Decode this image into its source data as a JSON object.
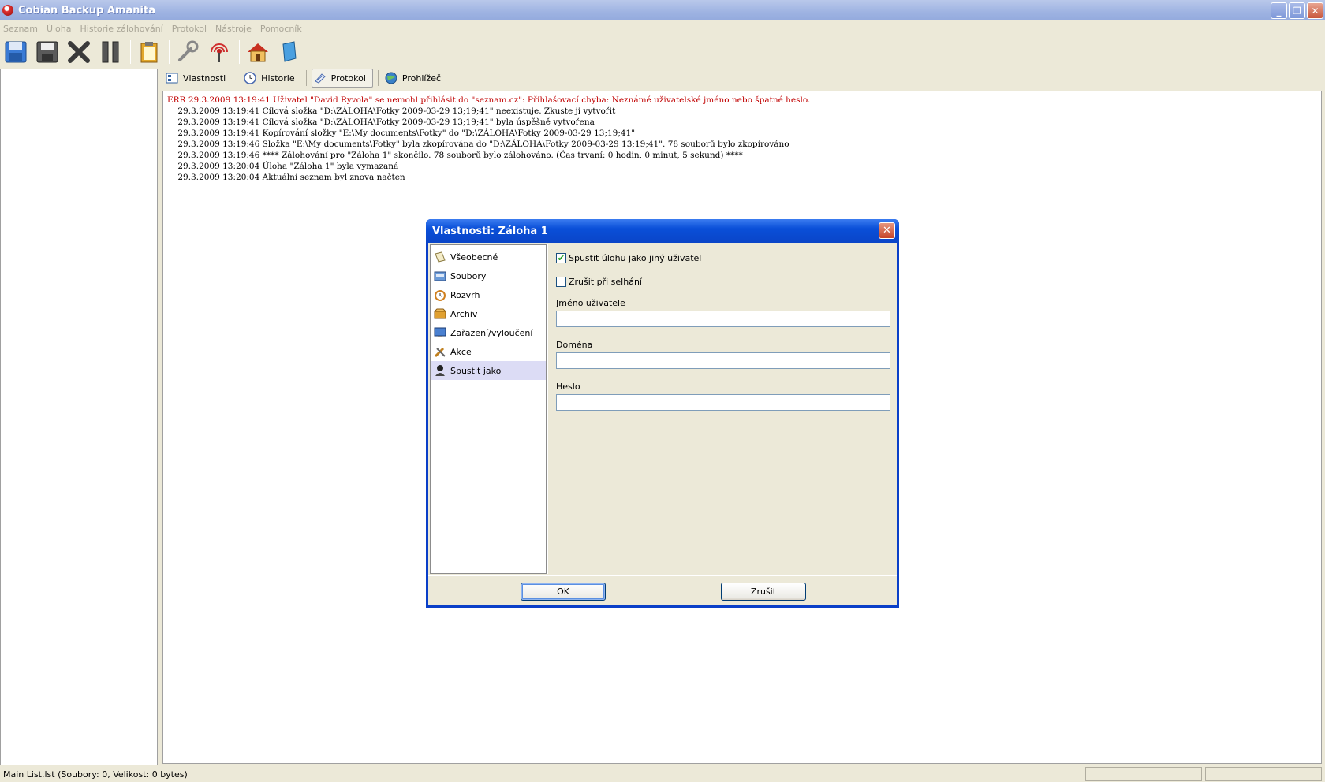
{
  "window": {
    "title": "Cobian Backup Amanita"
  },
  "menu": [
    "Seznam",
    "Úloha",
    "Historie zálohování",
    "Protokol",
    "Nástroje",
    "Pomocník"
  ],
  "toolbar": {
    "icons": [
      "backup-icon",
      "save-icon",
      "delete-icon",
      "pause-icon",
      "clipboard-icon",
      "wrench-icon",
      "antenna-icon",
      "home-icon",
      "book-icon"
    ]
  },
  "tabs": [
    {
      "label": "Vlastnosti",
      "icon": "properties-icon",
      "active": false
    },
    {
      "label": "Historie",
      "icon": "clock-icon",
      "active": false
    },
    {
      "label": "Protokol",
      "icon": "log-icon",
      "active": true
    },
    {
      "label": "Prohlížeč",
      "icon": "globe-icon",
      "active": false
    }
  ],
  "log": {
    "lines": [
      {
        "text": "ERR 29.3.2009 13:19:41 Uživatel \"David Ryvola\" se nemohl přihlásit do \"seznam.cz\": Přihlašovací chyba: Neznámé uživatelské jméno nebo špatné heslo.",
        "error": true
      },
      {
        "text": "    29.3.2009 13:19:41 Cílová složka \"D:\\ZÁLOHA\\Fotky 2009-03-29 13;19;41\" neexistuje. Zkuste ji vytvořit",
        "error": false
      },
      {
        "text": "    29.3.2009 13:19:41 Cílová složka \"D:\\ZÁLOHA\\Fotky 2009-03-29 13;19;41\" byla úspěšně vytvořena",
        "error": false
      },
      {
        "text": "    29.3.2009 13:19:41 Kopírování složky \"E:\\My documents\\Fotky\" do \"D:\\ZÁLOHA\\Fotky 2009-03-29 13;19;41\"",
        "error": false
      },
      {
        "text": "    29.3.2009 13:19:46 Složka \"E:\\My documents\\Fotky\" byla zkopírována do \"D:\\ZÁLOHA\\Fotky 2009-03-29 13;19;41\". 78 souborů bylo zkopírováno",
        "error": false
      },
      {
        "text": "    29.3.2009 13:19:46 **** Zálohování pro \"Záloha 1\" skončilo. 78 souborů bylo zálohováno. (Čas trvaní: 0 hodin, 0 minut, 5 sekund) ****",
        "error": false
      },
      {
        "text": "    29.3.2009 13:20:04 Úloha \"Záloha 1\" byla vymazaná",
        "error": false
      },
      {
        "text": "    29.3.2009 13:20:04 Aktuální seznam byl znova načten",
        "error": false
      }
    ]
  },
  "status": {
    "text": "Main List.lst (Soubory: 0, Velikost: 0 bytes)"
  },
  "dialog": {
    "title": "Vlastnosti: Záloha 1",
    "nav": [
      {
        "label": "Všeobecné",
        "icon": "general-icon",
        "selected": false
      },
      {
        "label": "Soubory",
        "icon": "files-icon",
        "selected": false
      },
      {
        "label": "Rozvrh",
        "icon": "alarm-clock-icon",
        "selected": false
      },
      {
        "label": "Archiv",
        "icon": "archive-icon",
        "selected": false
      },
      {
        "label": "Zařazení/vyloučení",
        "icon": "monitor-icon",
        "selected": false
      },
      {
        "label": "Akce",
        "icon": "tools-icon",
        "selected": false
      },
      {
        "label": "Spustit jako",
        "icon": "user-icon",
        "selected": true
      }
    ],
    "run_as_other_user": {
      "label": "Spustit úlohu jako jiný uživatel",
      "checked": true
    },
    "cancel_on_fail": {
      "label": "Zrušit při selhání",
      "checked": false
    },
    "username": {
      "label": "Jméno uživatele",
      "value": ""
    },
    "domain": {
      "label": "Doména",
      "value": ""
    },
    "password": {
      "label": "Heslo",
      "value": ""
    },
    "ok_label": "OK",
    "cancel_label": "Zrušit"
  }
}
